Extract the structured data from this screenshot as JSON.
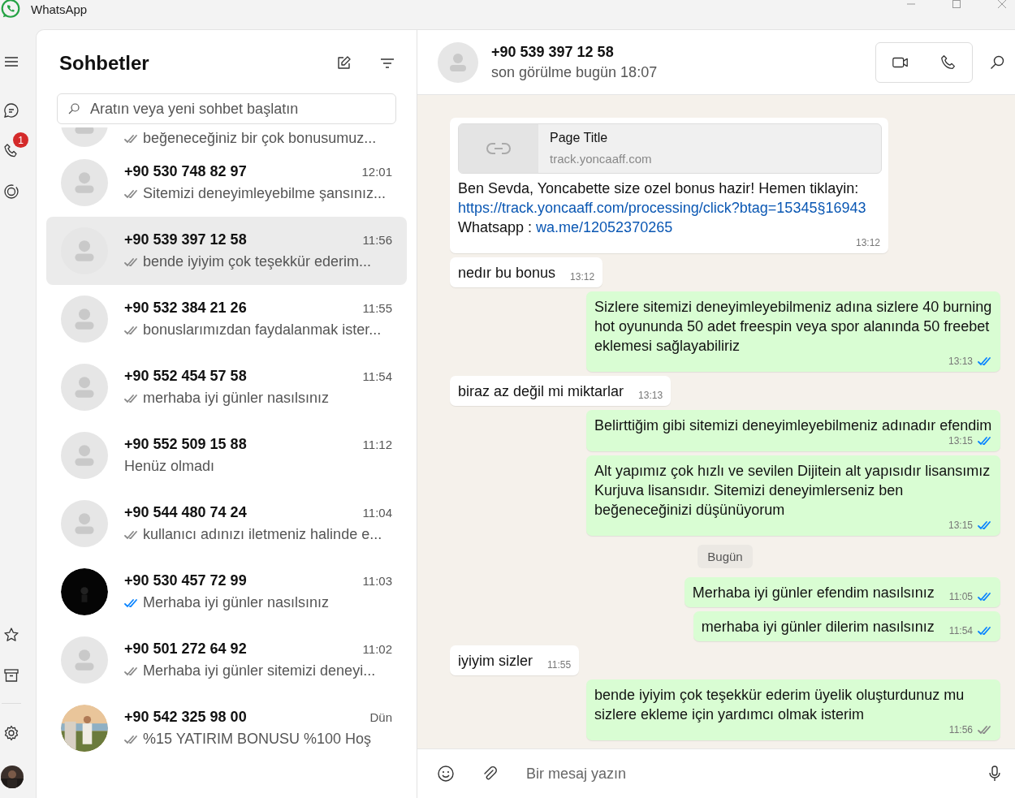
{
  "window": {
    "title": "WhatsApp"
  },
  "rail": {
    "calls_badge": "1"
  },
  "chat_list": {
    "title": "Sohbetler",
    "search_placeholder": "Aratın veya yeni sohbet başlatın",
    "chats": [
      {
        "partial": true,
        "preview": "beğeneceğiniz bir çok bonusumuz...",
        "ticks": true,
        "read": false,
        "photo": false,
        "selected": false
      },
      {
        "partial": false,
        "name": "+90 530 748 82 97",
        "time": "12:01",
        "preview": "Sitemizi deneyimleyebilme şansınız...",
        "ticks": true,
        "read": false,
        "photo": false,
        "selected": false
      },
      {
        "partial": false,
        "name": "+90 539 397 12 58",
        "time": "11:56",
        "preview": "bende iyiyim çok teşekkür ederim...",
        "ticks": true,
        "read": false,
        "photo": false,
        "selected": true
      },
      {
        "partial": false,
        "name": "+90 532 384 21 26",
        "time": "11:55",
        "preview": "bonuslarımızdan faydalanmak ister...",
        "ticks": true,
        "read": false,
        "photo": false,
        "selected": false
      },
      {
        "partial": false,
        "name": "+90 552 454 57 58",
        "time": "11:54",
        "preview": "merhaba iyi günler nasılsınız",
        "ticks": true,
        "read": false,
        "photo": false,
        "selected": false
      },
      {
        "partial": false,
        "name": "+90 552 509 15 88",
        "time": "11:12",
        "preview": "Henüz olmadı",
        "ticks": false,
        "photo": false,
        "selected": false
      },
      {
        "partial": false,
        "name": "+90 544 480 74 24",
        "time": "11:04",
        "preview": "kullanıcı adınızı iletmeniz halinde e...",
        "ticks": true,
        "read": false,
        "photo": false,
        "selected": false
      },
      {
        "partial": false,
        "name": "+90 530 457 72 99",
        "time": "11:03",
        "preview": "Merhaba iyi günler nasılsınız",
        "ticks": true,
        "read": true,
        "photo": true,
        "selected": false
      },
      {
        "partial": false,
        "name": "+90 501 272 64 92",
        "time": "11:02",
        "preview": "Merhaba iyi günler sitemizi deneyi...",
        "ticks": true,
        "read": false,
        "photo": false,
        "selected": false
      },
      {
        "partial": false,
        "name": "+90 542 325 98 00",
        "time": "Dün",
        "preview": "%15 YATIRIM BONUSU %100 Hoş",
        "ticks": true,
        "read": false,
        "photo": true,
        "selected": false
      }
    ]
  },
  "conversation": {
    "name": "+90 539 397 12 58",
    "last_seen": "son görülme bugün 18:07",
    "composer_placeholder": "Bir mesaj yazın",
    "messages": [
      {
        "kind": "in",
        "time": "13:12",
        "preview": {
          "title": "Page Title",
          "domain": "track.yoncaaff.com"
        },
        "lines": [
          [
            {
              "kind": "text",
              "text": "Ben Sevda, Yoncabette size ozel bonus hazir! Hemen tiklayin:"
            }
          ],
          [
            {
              "kind": "link",
              "text": "https://track.yoncaaff.com/processing/click?btag=15345§16943"
            }
          ],
          [
            {
              "kind": "text",
              "text": "Whatsapp : "
            },
            {
              "kind": "link",
              "text": "wa.me/12052370265"
            }
          ]
        ]
      },
      {
        "kind": "in",
        "time": "13:12",
        "text": "nedır bu bonus"
      },
      {
        "kind": "out",
        "time": "13:13",
        "read": true,
        "text": "Sizlere sitemizi deneyimleyebilmeniz adına sizlere 40 burning hot oyununda 50 adet freespin  veya spor alanında 50 freebet eklemesi sağlayabiliriz"
      },
      {
        "kind": "in",
        "time": "13:13",
        "text": "biraz az değil mi miktarlar"
      },
      {
        "kind": "out",
        "time": "13:15",
        "read": true,
        "text": "Belirttiğim gibi sitemizi deneyimleyebilmeniz adınadır efendim"
      },
      {
        "kind": "out",
        "time": "13:15",
        "read": true,
        "text": "Alt yapımız çok hızlı ve sevilen Dijitein alt yapısıdır lisansımız Kurjuva lisansıdır. Sitemizi deneyimlerseniz ben beğeneceğinizi düşünüyorum"
      },
      {
        "kind": "date",
        "text": "Bugün"
      },
      {
        "kind": "out",
        "time": "11:05",
        "read": true,
        "text": "Merhaba iyi günler efendim nasılsınız"
      },
      {
        "kind": "out",
        "time": "11:54",
        "read": true,
        "text": "merhaba iyi günler dilerim nasılsınız"
      },
      {
        "kind": "in",
        "time": "11:55",
        "text": "iyiyim sizler"
      },
      {
        "kind": "out",
        "time": "11:56",
        "read": false,
        "text": "bende iyiyim çok teşekkür ederim üyelik oluşturdunuz mu sizlere ekleme için yardımcı olmak isterim"
      }
    ]
  }
}
